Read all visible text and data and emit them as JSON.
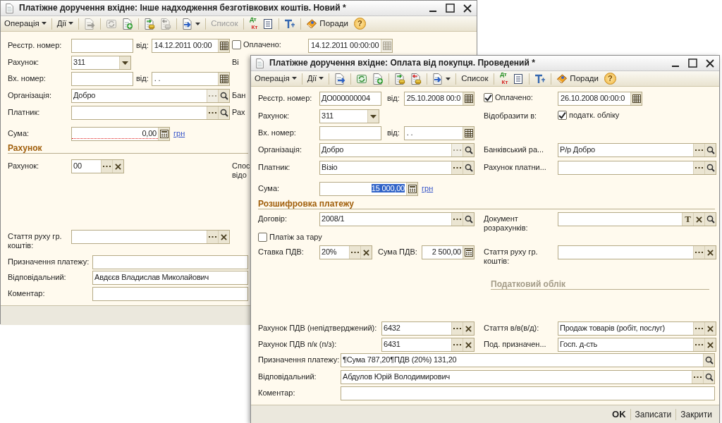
{
  "windows": [
    {
      "title": "Платіжне доручення вхідне: Інше надходження безготівкових коштів. Новий *",
      "toolbar": [
        {
          "kind": "menu",
          "label": "Операція",
          "disabled": false
        },
        {
          "kind": "separator"
        },
        {
          "kind": "menu",
          "label": "Дії",
          "disabled": false
        },
        {
          "kind": "separator"
        },
        {
          "kind": "post",
          "disabled": true
        },
        {
          "kind": "separator"
        },
        {
          "kind": "refresh",
          "disabled": true
        },
        {
          "kind": "copy",
          "disabled": false
        },
        {
          "kind": "separator"
        },
        {
          "kind": "coins-in",
          "disabled": false
        },
        {
          "kind": "coins-out",
          "disabled": true
        },
        {
          "kind": "separator"
        },
        {
          "kind": "send",
          "disabled": false
        },
        {
          "kind": "separator"
        },
        {
          "kind": "button",
          "label": "Список",
          "disabled": true
        },
        {
          "kind": "separator"
        },
        {
          "kind": "debit-credit",
          "top": "Дт",
          "bottom": "Кт",
          "disabled": false
        },
        {
          "kind": "journal",
          "disabled": false
        },
        {
          "kind": "separator"
        },
        {
          "kind": "structure",
          "disabled": false
        },
        {
          "kind": "separator"
        },
        {
          "kind": "tips",
          "label": "Поради",
          "disabled": false
        },
        {
          "kind": "help",
          "label": "?",
          "disabled": false
        }
      ],
      "rows": [
        {
          "kind": "pair",
          "left": [
            {
              "kind": "label",
              "text": "Реєстр. номер:"
            },
            {
              "kind": "code"
            },
            {
              "kind": "label",
              "text": "від:"
            },
            {
              "kind": "date",
              "value": "14.12.2011 00:00",
              "buttons": [
                {
                  "kind": "calendar",
                  "disabled": false
                }
              ]
            }
          ],
          "right": [
            {
              "kind": "checkbox",
              "text": "Оплачено:",
              "checked": false
            },
            {
              "kind": "date",
              "value": "14.12.2011 00:00:00",
              "buttons": [
                {
                  "kind": "calendar",
                  "disabled": true
                }
              ]
            }
          ]
        },
        {
          "kind": "pair",
          "left": [
            {
              "kind": "label",
              "text": "Рахунок:"
            },
            {
              "kind": "select",
              "value": "311",
              "buttons": [
                {
                  "kind": "dropdown",
                  "disabled": false
                }
              ]
            }
          ],
          "right": [
            {
              "kind": "label",
              "text": "Ві"
            }
          ]
        },
        {
          "kind": "pair",
          "left": [
            {
              "kind": "label",
              "text": "Вх. номер:"
            },
            {
              "kind": "code"
            },
            {
              "kind": "label",
              "text": "від:"
            },
            {
              "kind": "date",
              "value": ". .",
              "buttons": [
                {
                  "kind": "calendar",
                  "disabled": false
                }
              ]
            }
          ]
        },
        {
          "kind": "pair",
          "left": [
            {
              "kind": "label",
              "text": "Організація:"
            },
            {
              "kind": "ref",
              "value": "Добро",
              "buttons": [
                {
                  "kind": "choose",
                  "disabled": true
                },
                {
                  "kind": "search",
                  "disabled": false
                }
              ]
            }
          ],
          "right": [
            {
              "kind": "label",
              "text": "Бан"
            }
          ]
        },
        {
          "kind": "pair",
          "left": [
            {
              "kind": "label",
              "text": "Платник:"
            },
            {
              "kind": "ref",
              "buttons": [
                {
                  "kind": "choose",
                  "disabled": false
                },
                {
                  "kind": "search",
                  "disabled": false
                }
              ]
            }
          ],
          "right": [
            {
              "kind": "label",
              "text": "Рах"
            }
          ]
        },
        {
          "kind": "pair",
          "left": [
            {
              "kind": "label",
              "text": "Сума:"
            },
            {
              "kind": "amount",
              "value": "0,00",
              "required": true,
              "selected": false,
              "buttons": [
                {
                  "kind": "calculator",
                  "disabled": false
                }
              ]
            },
            {
              "kind": "link",
              "text": "грн"
            }
          ]
        },
        {
          "kind": "full",
          "items": [
            {
              "kind": "section-heading",
              "text": "Рахунок"
            }
          ]
        },
        {
          "kind": "pair",
          "left": [
            {
              "kind": "label",
              "text": "Рахунок:"
            },
            {
              "kind": "short",
              "value": "00",
              "buttons": [
                {
                  "kind": "choose",
                  "disabled": false
                },
                {
                  "kind": "clear",
                  "disabled": false
                }
              ]
            }
          ],
          "right": [
            {
              "kind": "label",
              "text": "Спос\nвідо"
            }
          ]
        },
        {
          "kind": "pair",
          "left": [
            {
              "kind": "label",
              "text": "Стаття руху гр.\nкоштів:"
            },
            {
              "kind": "ref",
              "buttons": [
                {
                  "kind": "choose",
                  "disabled": false
                },
                {
                  "kind": "clear",
                  "disabled": false
                }
              ]
            }
          ]
        },
        {
          "kind": "full",
          "items": [
            {
              "kind": "label",
              "text": "Призначення платежу:"
            },
            {
              "kind": "text"
            }
          ]
        },
        {
          "kind": "full",
          "items": [
            {
              "kind": "label",
              "text": "Відповідальний:"
            },
            {
              "kind": "text",
              "value": "Авдєєв Владислав Миколайович"
            }
          ]
        },
        {
          "kind": "full",
          "items": [
            {
              "kind": "label",
              "text": "Коментар:"
            },
            {
              "kind": "text"
            }
          ]
        }
      ]
    },
    {
      "title": "Платіжне доручення вхідне: Оплата від покупця. Проведений *",
      "toolbar": [
        {
          "kind": "menu",
          "label": "Операція",
          "disabled": false
        },
        {
          "kind": "separator"
        },
        {
          "kind": "menu",
          "label": "Дії",
          "disabled": false
        },
        {
          "kind": "separator"
        },
        {
          "kind": "post",
          "disabled": false
        },
        {
          "kind": "separator"
        },
        {
          "kind": "refresh",
          "disabled": false
        },
        {
          "kind": "copy",
          "disabled": false
        },
        {
          "kind": "separator"
        },
        {
          "kind": "coins-in",
          "disabled": false
        },
        {
          "kind": "coins-out",
          "disabled": false
        },
        {
          "kind": "separator"
        },
        {
          "kind": "send",
          "disabled": false
        },
        {
          "kind": "separator"
        },
        {
          "kind": "button",
          "label": "Список",
          "disabled": false
        },
        {
          "kind": "separator"
        },
        {
          "kind": "debit-credit",
          "top": "Дт",
          "bottom": "Кт",
          "disabled": false
        },
        {
          "kind": "journal",
          "disabled": false
        },
        {
          "kind": "separator"
        },
        {
          "kind": "structure",
          "disabled": false
        },
        {
          "kind": "separator"
        },
        {
          "kind": "tips",
          "label": "Поради",
          "disabled": false
        },
        {
          "kind": "help",
          "label": "?",
          "disabled": false
        }
      ],
      "rows": [
        {
          "kind": "pair",
          "left": [
            {
              "kind": "label",
              "text": "Реєстр. номер:"
            },
            {
              "kind": "code",
              "value": "ДО000000004"
            },
            {
              "kind": "label",
              "text": "від:"
            },
            {
              "kind": "date",
              "value": "25.10.2008 00:0",
              "buttons": [
                {
                  "kind": "calendar",
                  "disabled": false
                }
              ]
            }
          ],
          "right": [
            {
              "kind": "checkbox",
              "text": "Оплачено:",
              "checked": true
            },
            {
              "kind": "date",
              "value": "26.10.2008 00:00:0",
              "buttons": [
                {
                  "kind": "calendar",
                  "disabled": false
                }
              ]
            }
          ]
        },
        {
          "kind": "pair",
          "left": [
            {
              "kind": "label",
              "text": "Рахунок:"
            },
            {
              "kind": "select",
              "value": "311",
              "buttons": [
                {
                  "kind": "dropdown",
                  "disabled": false
                }
              ]
            }
          ],
          "right": [
            {
              "kind": "label",
              "text": "Відобразити в:"
            },
            {
              "kind": "checkbox",
              "text": "податк. обліку",
              "checked": true
            }
          ]
        },
        {
          "kind": "pair",
          "left": [
            {
              "kind": "label",
              "text": "Вх. номер:"
            },
            {
              "kind": "code"
            },
            {
              "kind": "label",
              "text": "від:"
            },
            {
              "kind": "date",
              "value": ". .",
              "buttons": [
                {
                  "kind": "calendar",
                  "disabled": false
                }
              ]
            }
          ]
        },
        {
          "kind": "pair",
          "left": [
            {
              "kind": "label",
              "text": "Організація:"
            },
            {
              "kind": "ref",
              "value": "Добро",
              "buttons": [
                {
                  "kind": "choose",
                  "disabled": true
                },
                {
                  "kind": "search",
                  "disabled": false
                }
              ]
            }
          ],
          "right": [
            {
              "kind": "label",
              "text": "Банківський ра..."
            },
            {
              "kind": "ref",
              "value": "Р/р Добро",
              "buttons": [
                {
                  "kind": "choose",
                  "disabled": false
                },
                {
                  "kind": "search",
                  "disabled": false
                }
              ]
            }
          ]
        },
        {
          "kind": "pair",
          "left": [
            {
              "kind": "label",
              "text": "Платник:"
            },
            {
              "kind": "ref",
              "value": "Візіо",
              "buttons": [
                {
                  "kind": "choose",
                  "disabled": false
                },
                {
                  "kind": "search",
                  "disabled": false
                }
              ]
            }
          ],
          "right": [
            {
              "kind": "label",
              "text": "Рахунок платни..."
            },
            {
              "kind": "ref",
              "buttons": [
                {
                  "kind": "choose",
                  "disabled": false
                },
                {
                  "kind": "search",
                  "disabled": false
                }
              ]
            }
          ]
        },
        {
          "kind": "pair",
          "left": [
            {
              "kind": "label",
              "text": "Сума:"
            },
            {
              "kind": "amount",
              "value": "15 000,00",
              "required": false,
              "selected": true,
              "buttons": [
                {
                  "kind": "calculator",
                  "disabled": false
                }
              ]
            },
            {
              "kind": "link",
              "text": "грн"
            }
          ]
        },
        {
          "kind": "full",
          "items": [
            {
              "kind": "section-heading",
              "text": "Розшифровка платежу"
            }
          ]
        },
        {
          "kind": "pair",
          "left": [
            {
              "kind": "label",
              "text": "Договір:"
            },
            {
              "kind": "ref",
              "value": "2008/1",
              "buttons": [
                {
                  "kind": "choose",
                  "disabled": false
                },
                {
                  "kind": "search",
                  "disabled": false
                }
              ]
            }
          ],
          "right": [
            {
              "kind": "label",
              "text": "Документ\nрозрахунків:"
            },
            {
              "kind": "ref",
              "buttons": [
                {
                  "kind": "letter",
                  "label": "T",
                  "disabled": false
                },
                {
                  "kind": "clear",
                  "disabled": false
                },
                {
                  "kind": "search",
                  "disabled": false
                }
              ]
            }
          ]
        },
        {
          "kind": "pair",
          "left": [
            {
              "kind": "checkbox",
              "text": "Платіж за тару",
              "checked": false
            }
          ]
        },
        {
          "kind": "pair",
          "left": [
            {
              "kind": "label",
              "text": "Ставка ПДВ:"
            },
            {
              "kind": "short",
              "value": "20%",
              "buttons": [
                {
                  "kind": "choose",
                  "disabled": false
                },
                {
                  "kind": "clear",
                  "disabled": false
                }
              ]
            },
            {
              "kind": "label",
              "text": "Сума ПДВ:"
            },
            {
              "kind": "number",
              "value": "2 500,00",
              "buttons": [
                {
                  "kind": "calculator",
                  "disabled": false
                }
              ]
            }
          ],
          "right": [
            {
              "kind": "label",
              "text": "Стаття руху гр.\nкоштів:"
            },
            {
              "kind": "ref",
              "buttons": [
                {
                  "kind": "choose",
                  "disabled": false
                },
                {
                  "kind": "clear",
                  "disabled": false
                }
              ]
            }
          ]
        },
        {
          "kind": "pair",
          "right": [
            {
              "kind": "muted-heading",
              "text": "Податковий облік"
            }
          ]
        },
        {
          "kind": "pair",
          "left": [
            {
              "kind": "label",
              "text": "Рахунок ПДВ (непідтверджений):"
            },
            {
              "kind": "ref",
              "value": "6432",
              "buttons": [
                {
                  "kind": "choose",
                  "disabled": false
                },
                {
                  "kind": "clear",
                  "disabled": false
                }
              ]
            }
          ],
          "right": [
            {
              "kind": "label",
              "text": "Стаття в/в(в/д):"
            },
            {
              "kind": "ref",
              "value": "Продаж товарів (робіт, послуг)",
              "buttons": [
                {
                  "kind": "choose",
                  "disabled": false
                },
                {
                  "kind": "clear",
                  "disabled": false
                }
              ]
            }
          ]
        },
        {
          "kind": "pair",
          "left": [
            {
              "kind": "label",
              "text": "Рахунок ПДВ п/к (п/з):"
            },
            {
              "kind": "ref",
              "value": "6431",
              "buttons": [
                {
                  "kind": "choose",
                  "disabled": false
                },
                {
                  "kind": "clear",
                  "disabled": false
                }
              ]
            }
          ],
          "right": [
            {
              "kind": "label",
              "text": "Под. призначен..."
            },
            {
              "kind": "ref",
              "value": "Госп. д-сть",
              "buttons": [
                {
                  "kind": "choose",
                  "disabled": false
                },
                {
                  "kind": "clear",
                  "disabled": false
                }
              ]
            }
          ]
        },
        {
          "kind": "full",
          "items": [
            {
              "kind": "label",
              "text": "Призначення платежу:"
            },
            {
              "kind": "text",
              "value": "¶Сума 787,20¶ПДВ (20%) 131,20",
              "buttons": [
                {
                  "kind": "search",
                  "disabled": false
                }
              ]
            }
          ]
        },
        {
          "kind": "full",
          "items": [
            {
              "kind": "label",
              "text": "Відповідальний:"
            },
            {
              "kind": "text",
              "value": "Абдулов Юрій Володимирович",
              "buttons": [
                {
                  "kind": "choose",
                  "disabled": false
                },
                {
                  "kind": "search",
                  "disabled": false
                }
              ]
            }
          ]
        },
        {
          "kind": "full",
          "items": [
            {
              "kind": "label",
              "text": "Коментар:"
            },
            {
              "kind": "text"
            }
          ]
        }
      ],
      "footer": [
        {
          "label": "OK",
          "default": true
        },
        {
          "label": "Записати",
          "default": false
        },
        {
          "label": "Закрити",
          "default": false
        }
      ]
    }
  ]
}
